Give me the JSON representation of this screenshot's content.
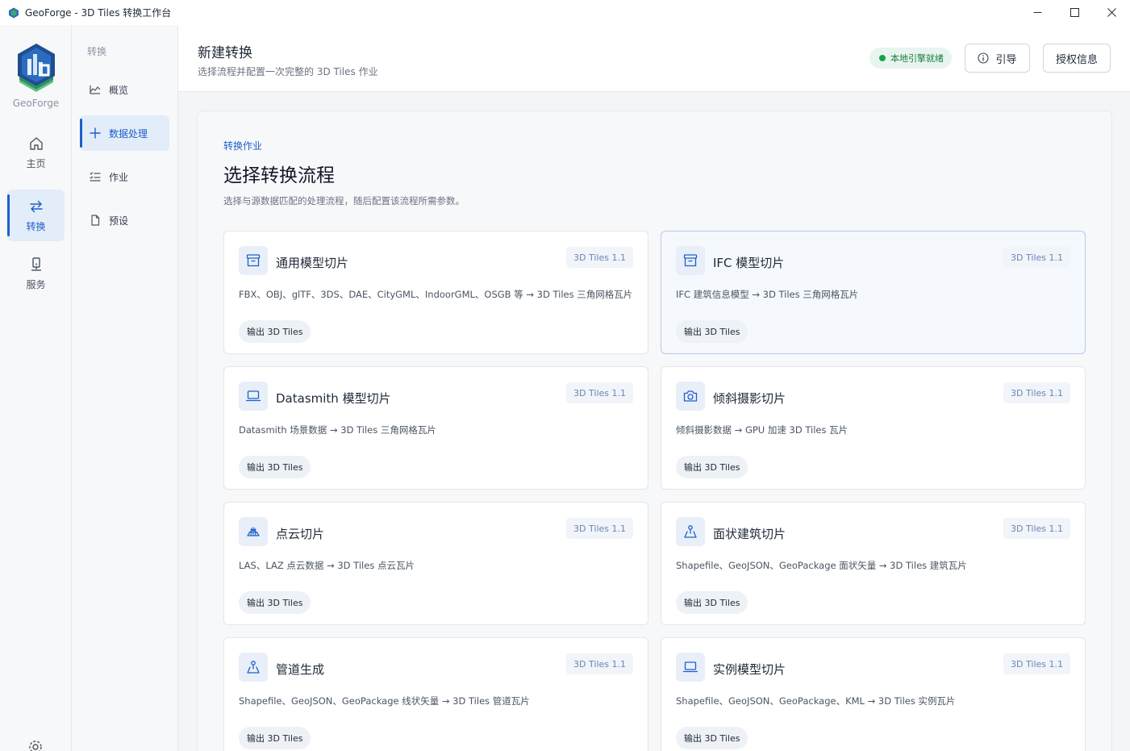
{
  "window": {
    "title": "GeoForge - 3D Tiles 转换工作台",
    "controls": [
      "minimize",
      "maximize",
      "close"
    ]
  },
  "rail": {
    "brand": "GeoForge",
    "items": [
      {
        "label": "主页",
        "icon": "home-icon"
      },
      {
        "label": "转换",
        "icon": "convert-icon",
        "active": true
      },
      {
        "label": "服务",
        "icon": "server-icon"
      }
    ]
  },
  "subnav": {
    "section": "转换",
    "items": [
      {
        "label": "概览",
        "icon": "chart-icon"
      },
      {
        "label": "数据处理",
        "icon": "plus-icon",
        "active": true
      },
      {
        "label": "作业",
        "icon": "list-icon"
      },
      {
        "label": "预设",
        "icon": "file-icon"
      }
    ]
  },
  "header": {
    "title": "新建转换",
    "subtitle": "选择流程并配置一次完整的 3D Tiles 作业",
    "status": "本地引擎就绪",
    "status_color": "#16a34a",
    "guide_label": "引导",
    "license_label": "授权信息"
  },
  "main": {
    "eyebrow": "转换作业",
    "title": "选择转换流程",
    "subtitle": "选择与源数据匹配的处理流程，随后配置该流程所需参数。",
    "cards": [
      {
        "title": "通用模型切片",
        "badge": "3D Tiles 1.1",
        "desc": "FBX、OBJ、glTF、3DS、DAE、CityGML、IndoorGML、OSGB 等 → 3D Tiles 三角网格瓦片",
        "chip": "输出 3D Tiles",
        "icon": "archive-box-icon"
      },
      {
        "title": "IFC 模型切片",
        "badge": "3D Tiles 1.1",
        "desc": "IFC 建筑信息模型 → 3D Tiles 三角网格瓦片",
        "chip": "输出 3D Tiles",
        "icon": "archive-box-icon",
        "selected": true
      },
      {
        "title": "Datasmith 模型切片",
        "badge": "3D Tiles 1.1",
        "desc": "Datasmith 场景数据 → 3D Tiles 三角网格瓦片",
        "chip": "输出 3D Tiles",
        "icon": "laptop-icon"
      },
      {
        "title": "倾斜摄影切片",
        "badge": "3D Tiles 1.1",
        "desc": "倾斜摄影数据 → GPU 加速 3D Tiles 瓦片",
        "chip": "输出 3D Tiles",
        "icon": "camera-icon"
      },
      {
        "title": "点云切片",
        "badge": "3D Tiles 1.1",
        "desc": "LAS、LAZ 点云数据 → 3D Tiles 点云瓦片",
        "chip": "输出 3D Tiles",
        "icon": "grid-globe-icon"
      },
      {
        "title": "面状建筑切片",
        "badge": "3D Tiles 1.1",
        "desc": "Shapefile、GeoJSON、GeoPackage 面状矢量 → 3D Tiles 建筑瓦片",
        "chip": "输出 3D Tiles",
        "icon": "map-pin-icon"
      },
      {
        "title": "管道生成",
        "badge": "3D Tiles 1.1",
        "desc": "Shapefile、GeoJSON、GeoPackage 线状矢量 → 3D Tiles 管道瓦片",
        "chip": "输出 3D Tiles",
        "icon": "map-pin-icon"
      },
      {
        "title": "实例模型切片",
        "badge": "3D Tiles 1.1",
        "desc": "Shapefile、GeoJSON、GeoPackage、KML → 3D Tiles 实例瓦片",
        "chip": "输出 3D Tiles",
        "icon": "laptop-icon"
      }
    ]
  },
  "colors": {
    "accent": "#1d5fc9",
    "rail_bg": "#f7f8fa",
    "main_bg": "#f3f5f8"
  }
}
